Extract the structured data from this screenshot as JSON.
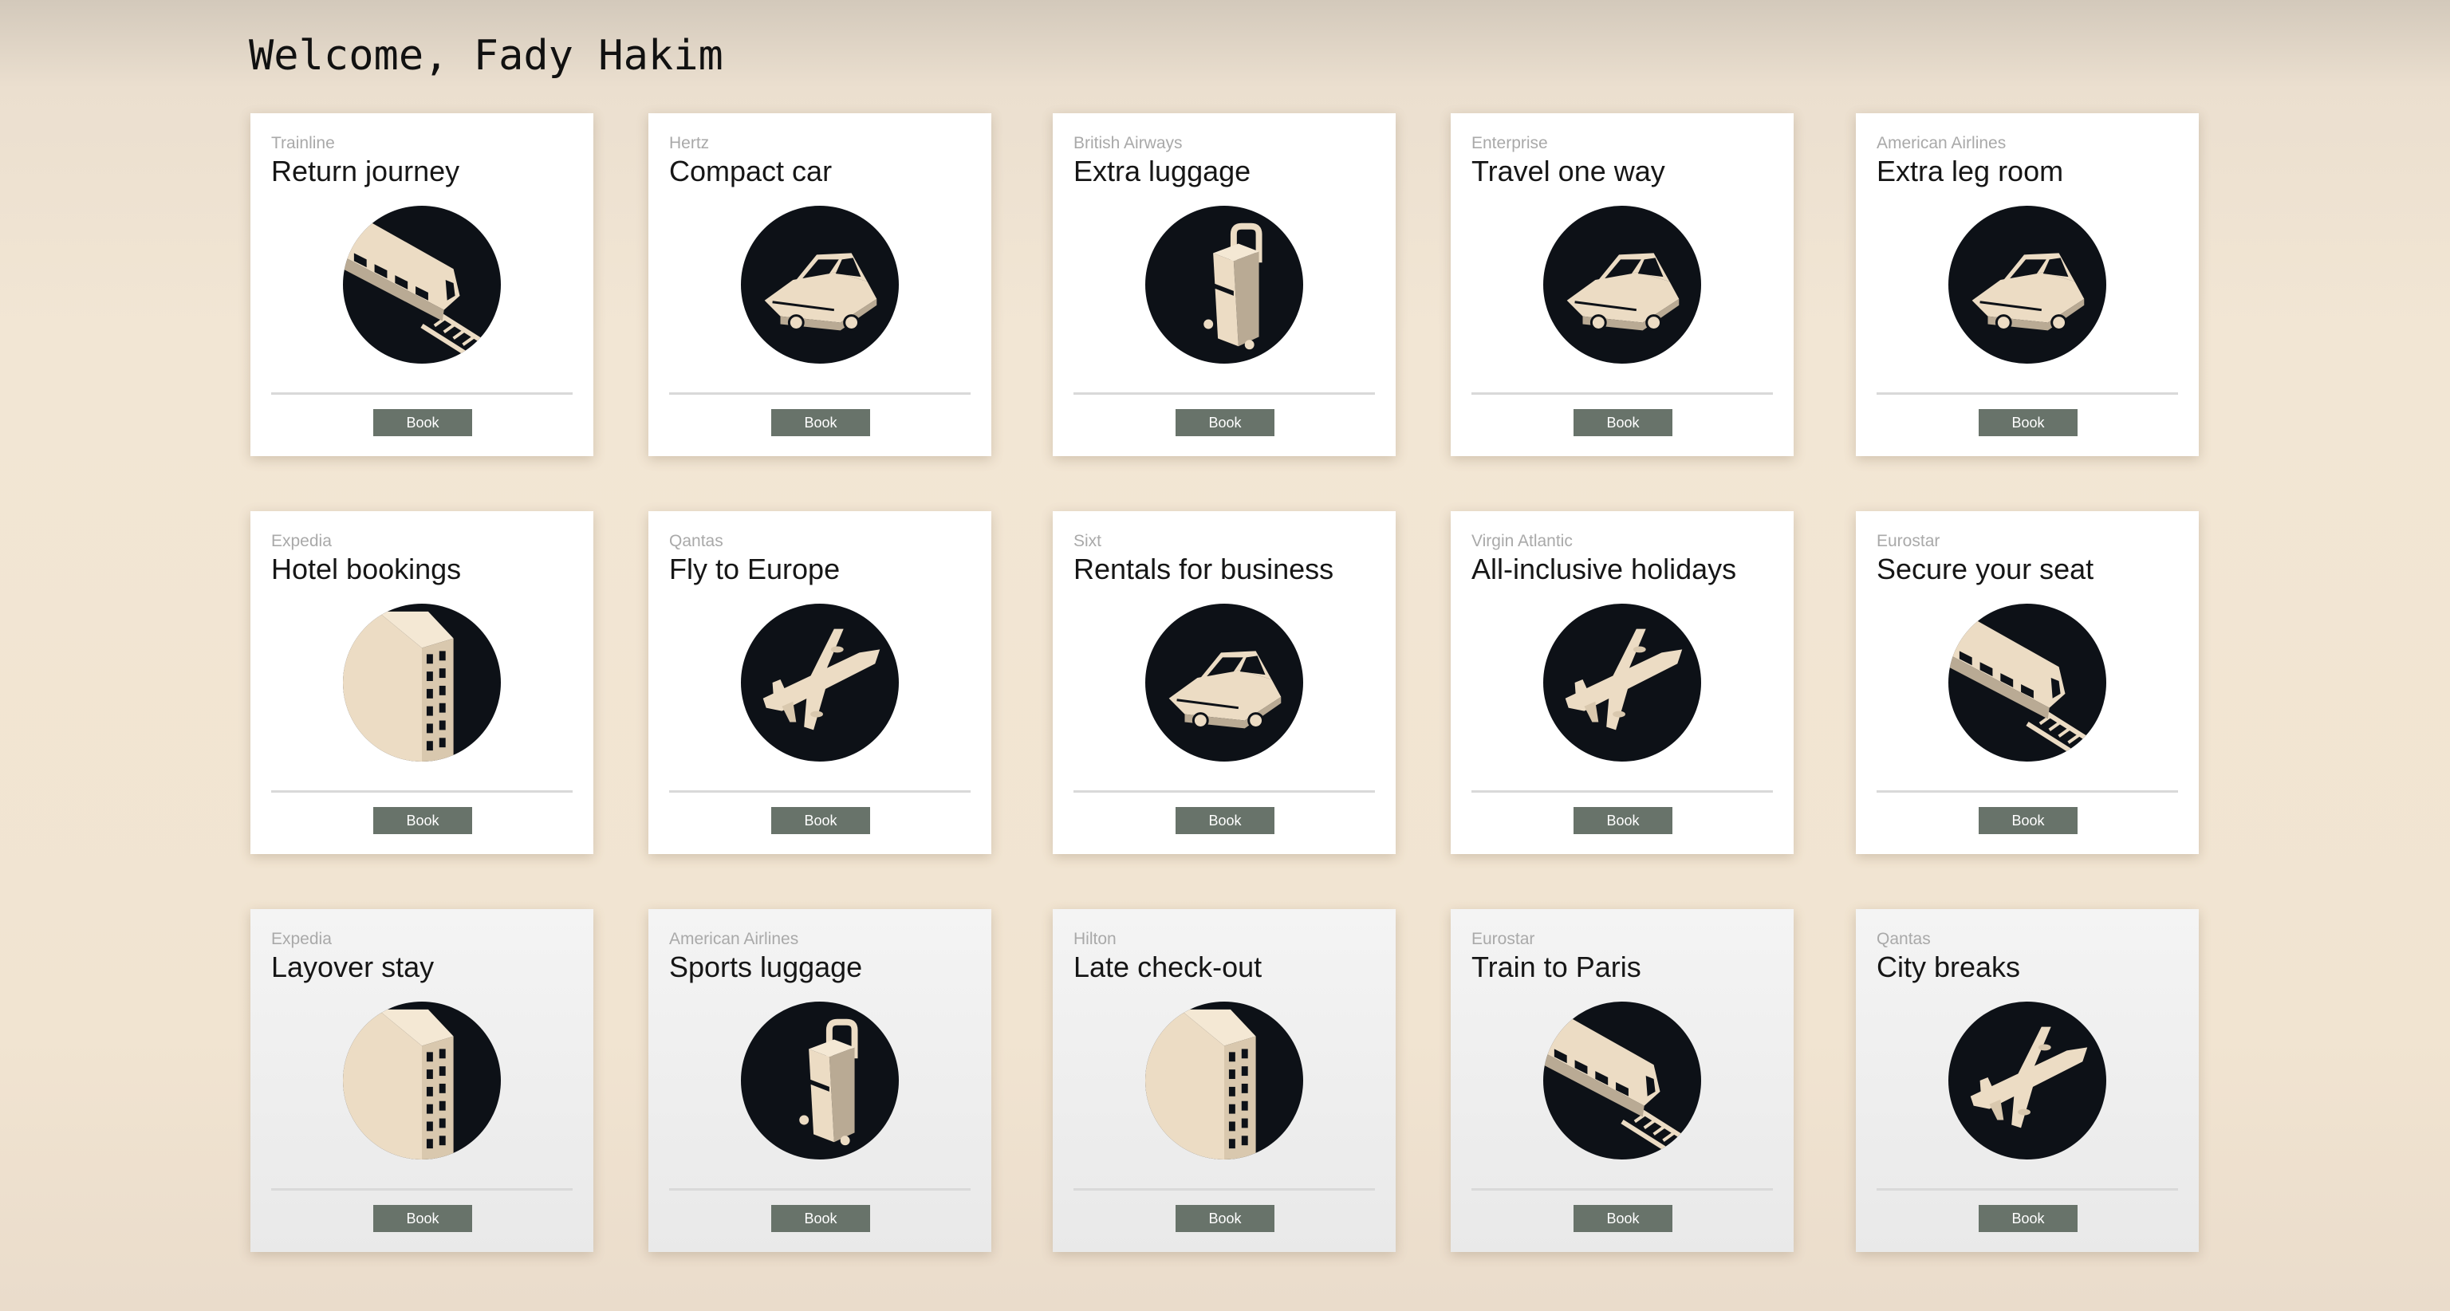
{
  "header": {
    "welcome": "Welcome, Fady Hakim"
  },
  "colors": {
    "background": "#f1e4d1",
    "card": "#ffffff",
    "icon_circle": "#0d1117",
    "icon_fill": "#ecdcc4",
    "button": "#68736a"
  },
  "cards": [
    {
      "provider": "Trainline",
      "title": "Return journey",
      "icon": "train-icon",
      "button": "Book"
    },
    {
      "provider": "Hertz",
      "title": "Compact car",
      "icon": "car-icon",
      "button": "Book"
    },
    {
      "provider": "British Airways",
      "title": "Extra luggage",
      "icon": "luggage-icon",
      "button": "Book"
    },
    {
      "provider": "Enterprise",
      "title": "Travel one way",
      "icon": "car-icon",
      "button": "Book"
    },
    {
      "provider": "American Airlines",
      "title": "Extra leg room",
      "icon": "car-icon",
      "button": "Book"
    },
    {
      "provider": "Expedia",
      "title": "Hotel bookings",
      "icon": "hotel-icon",
      "button": "Book"
    },
    {
      "provider": "Qantas",
      "title": "Fly to Europe",
      "icon": "airplane-icon",
      "button": "Book"
    },
    {
      "provider": "Sixt",
      "title": "Rentals for business",
      "icon": "car-icon",
      "button": "Book"
    },
    {
      "provider": "Virgin Atlantic",
      "title": "All-inclusive holidays",
      "icon": "airplane-icon",
      "button": "Book"
    },
    {
      "provider": "Eurostar",
      "title": "Secure your seat",
      "icon": "train-icon",
      "button": "Book"
    },
    {
      "provider": "Expedia",
      "title": "Layover stay",
      "icon": "hotel-icon",
      "button": "Book"
    },
    {
      "provider": "American Airlines",
      "title": "Sports luggage",
      "icon": "luggage-icon",
      "button": "Book"
    },
    {
      "provider": "Hilton",
      "title": "Late check-out",
      "icon": "hotel-icon",
      "button": "Book"
    },
    {
      "provider": "Eurostar",
      "title": "Train to Paris",
      "icon": "train-icon",
      "button": "Book"
    },
    {
      "provider": "Qantas",
      "title": "City breaks",
      "icon": "airplane-icon",
      "button": "Book"
    }
  ]
}
